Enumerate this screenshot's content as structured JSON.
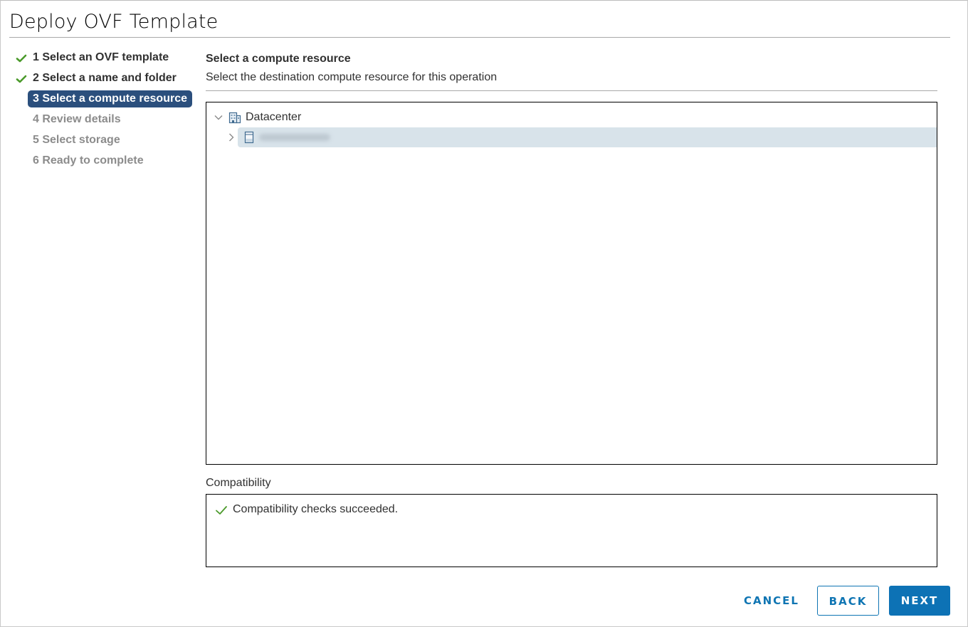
{
  "dialog": {
    "title": "Deploy OVF Template"
  },
  "steps": [
    {
      "number": "1",
      "label": "1 Select an OVF template",
      "state": "completed"
    },
    {
      "number": "2",
      "label": "2 Select a name and folder",
      "state": "completed"
    },
    {
      "number": "3",
      "label": "3 Select a compute resource",
      "state": "active"
    },
    {
      "number": "4",
      "label": "4 Review details",
      "state": "pending"
    },
    {
      "number": "5",
      "label": "5 Select storage",
      "state": "pending"
    },
    {
      "number": "6",
      "label": "6 Ready to complete",
      "state": "pending"
    }
  ],
  "content": {
    "heading": "Select a compute resource",
    "description": "Select the destination compute resource for this operation"
  },
  "tree": {
    "items": [
      {
        "label": "Datacenter",
        "icon": "datacenter-icon",
        "expanded": true,
        "level": 0
      },
      {
        "label": "",
        "icon": "host-icon",
        "expanded": false,
        "level": 1,
        "selected": true,
        "redacted": true
      }
    ]
  },
  "compatibility": {
    "label": "Compatibility",
    "message": "Compatibility checks succeeded.",
    "status": "success"
  },
  "buttons": {
    "cancel": "CANCEL",
    "back": "BACK",
    "next": "NEXT"
  },
  "colors": {
    "accent": "#0d72b5",
    "active_step": "#2b4f7d",
    "success": "#4b9a2b",
    "selection": "#d8e3ea"
  }
}
